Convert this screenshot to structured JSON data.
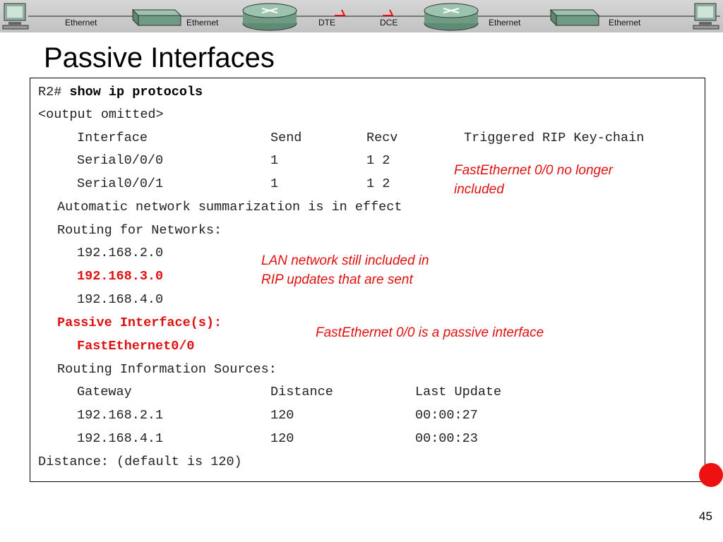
{
  "banner": {
    "labels": [
      "Ethernet",
      "Ethernet",
      "DTE",
      "DCE",
      "Ethernet",
      "Ethernet"
    ],
    "icons": [
      "pc-icon",
      "switch-icon",
      "router-icon",
      "serial-link-icon",
      "router-icon",
      "switch-icon",
      "pc-icon"
    ]
  },
  "title": "Passive Interfaces",
  "terminal": {
    "prompt": "R2# ",
    "command": "show ip protocols",
    "omitted": "<output omitted>",
    "iface_header": {
      "interface": "Interface",
      "send": "Send",
      "recv": "Recv",
      "rest": "Triggered RIP Key-chain"
    },
    "iface_rows": [
      {
        "name": "Serial0/0/0",
        "send": "1",
        "recv": "1 2"
      },
      {
        "name": "Serial0/0/1",
        "send": "1",
        "recv": "1 2"
      }
    ],
    "auto_summary": "Automatic network summarization is in effect",
    "routing_networks": "Routing for Networks:",
    "networks": [
      "192.168.2.0",
      "192.168.3.0",
      "192.168.4.0"
    ],
    "passive_label": "Passive Interface(s):",
    "passive_iface": "FastEthernet0/0",
    "info_sources": "Routing Information Sources:",
    "gw_header": {
      "gateway": "Gateway",
      "distance": "Distance",
      "last": "Last Update"
    },
    "gw_rows": [
      {
        "gateway": "192.168.2.1",
        "distance": "120",
        "last": "00:00:27"
      },
      {
        "gateway": "192.168.4.1",
        "distance": "120",
        "last": "00:00:23"
      }
    ],
    "default_distance": "Distance: (default is 120)"
  },
  "notes": {
    "fa_no_longer_1": "FastEthernet 0/0 no longer",
    "fa_no_longer_2": "included",
    "lan_still_1": "LAN network still included in",
    "lan_still_2": "RIP updates that are sent",
    "fa_passive": "FastEthernet 0/0 is a passive interface"
  },
  "colors": {
    "accent_red": "#e01010",
    "banner_gray": "#c8c8c8",
    "dot_red": "#ee1111"
  },
  "page_number": "45"
}
